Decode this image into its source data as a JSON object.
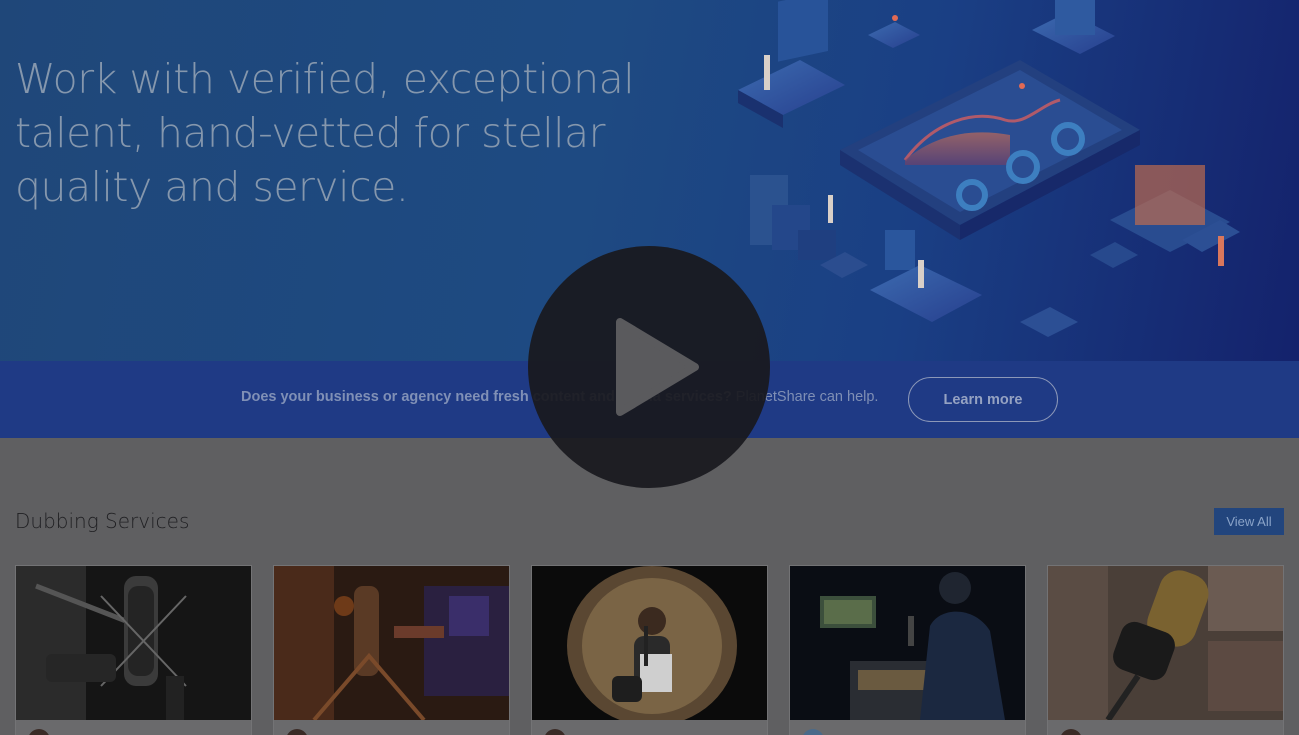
{
  "hero": {
    "title": "Work with verified, exceptional talent, hand-vetted for stellar quality and service.",
    "illustration_icon": "isometric-data-dashboard-illustration"
  },
  "banner": {
    "text_bold": "Does your business or agency need fresh content and media services?",
    "text_normal": " PlanetShare can help.",
    "learn_more_label": "Learn more"
  },
  "section": {
    "title": "Dubbing Services",
    "view_all_label": "View All"
  },
  "cards": [
    {
      "image": "studio-microphone-bw"
    },
    {
      "image": "microphone-stand-warm-lights"
    },
    {
      "image": "girl-recording-vocals"
    },
    {
      "image": "engineer-at-mixing-console"
    },
    {
      "image": "gold-condenser-microphone"
    }
  ],
  "video": {
    "icon": "play-icon"
  },
  "colors": {
    "hero_bg": "#1e4a82",
    "banner_bg": "#1f3a85",
    "page_bg": "#5f5f61",
    "accent": "#22457d"
  }
}
